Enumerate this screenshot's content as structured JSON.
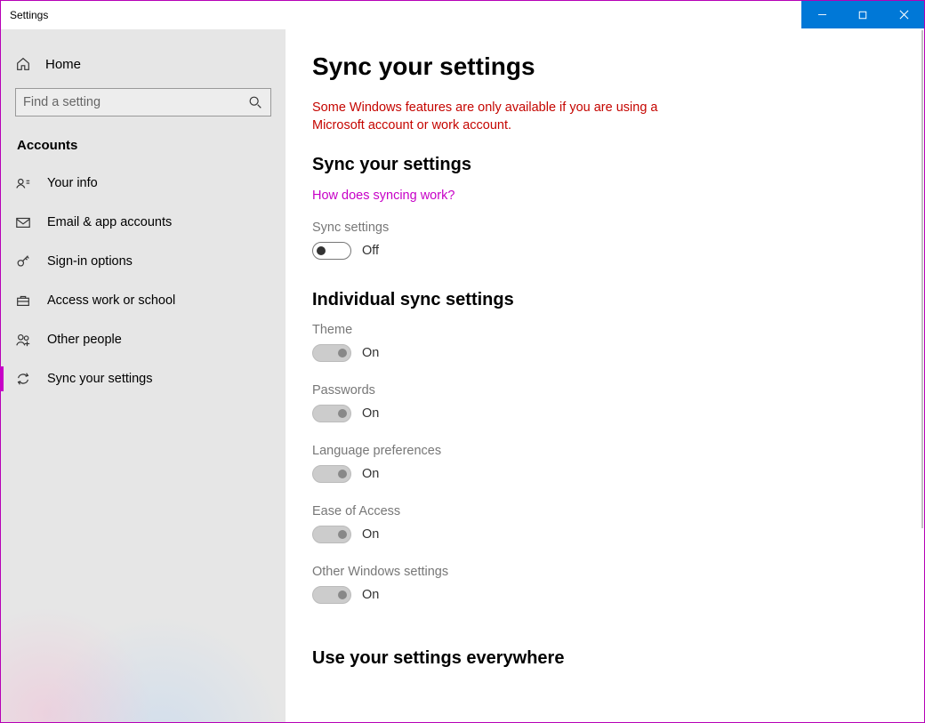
{
  "window": {
    "title": "Settings"
  },
  "sidebar": {
    "home_label": "Home",
    "search_placeholder": "Find a setting",
    "section_label": "Accounts",
    "items": [
      {
        "label": "Your info"
      },
      {
        "label": "Email & app accounts"
      },
      {
        "label": "Sign-in options"
      },
      {
        "label": "Access work or school"
      },
      {
        "label": "Other people"
      },
      {
        "label": "Sync your settings"
      }
    ]
  },
  "main": {
    "title": "Sync your settings",
    "warning": "Some Windows features are only available if you are using a Microsoft account or work account.",
    "section1_heading": "Sync your settings",
    "help_link": "How does syncing work?",
    "sync_label": "Sync settings",
    "sync_state": "Off",
    "section2_heading": "Individual sync settings",
    "individual": [
      {
        "label": "Theme",
        "state": "On"
      },
      {
        "label": "Passwords",
        "state": "On"
      },
      {
        "label": "Language preferences",
        "state": "On"
      },
      {
        "label": "Ease of Access",
        "state": "On"
      },
      {
        "label": "Other Windows settings",
        "state": "On"
      }
    ],
    "section3_heading": "Use your settings everywhere"
  }
}
